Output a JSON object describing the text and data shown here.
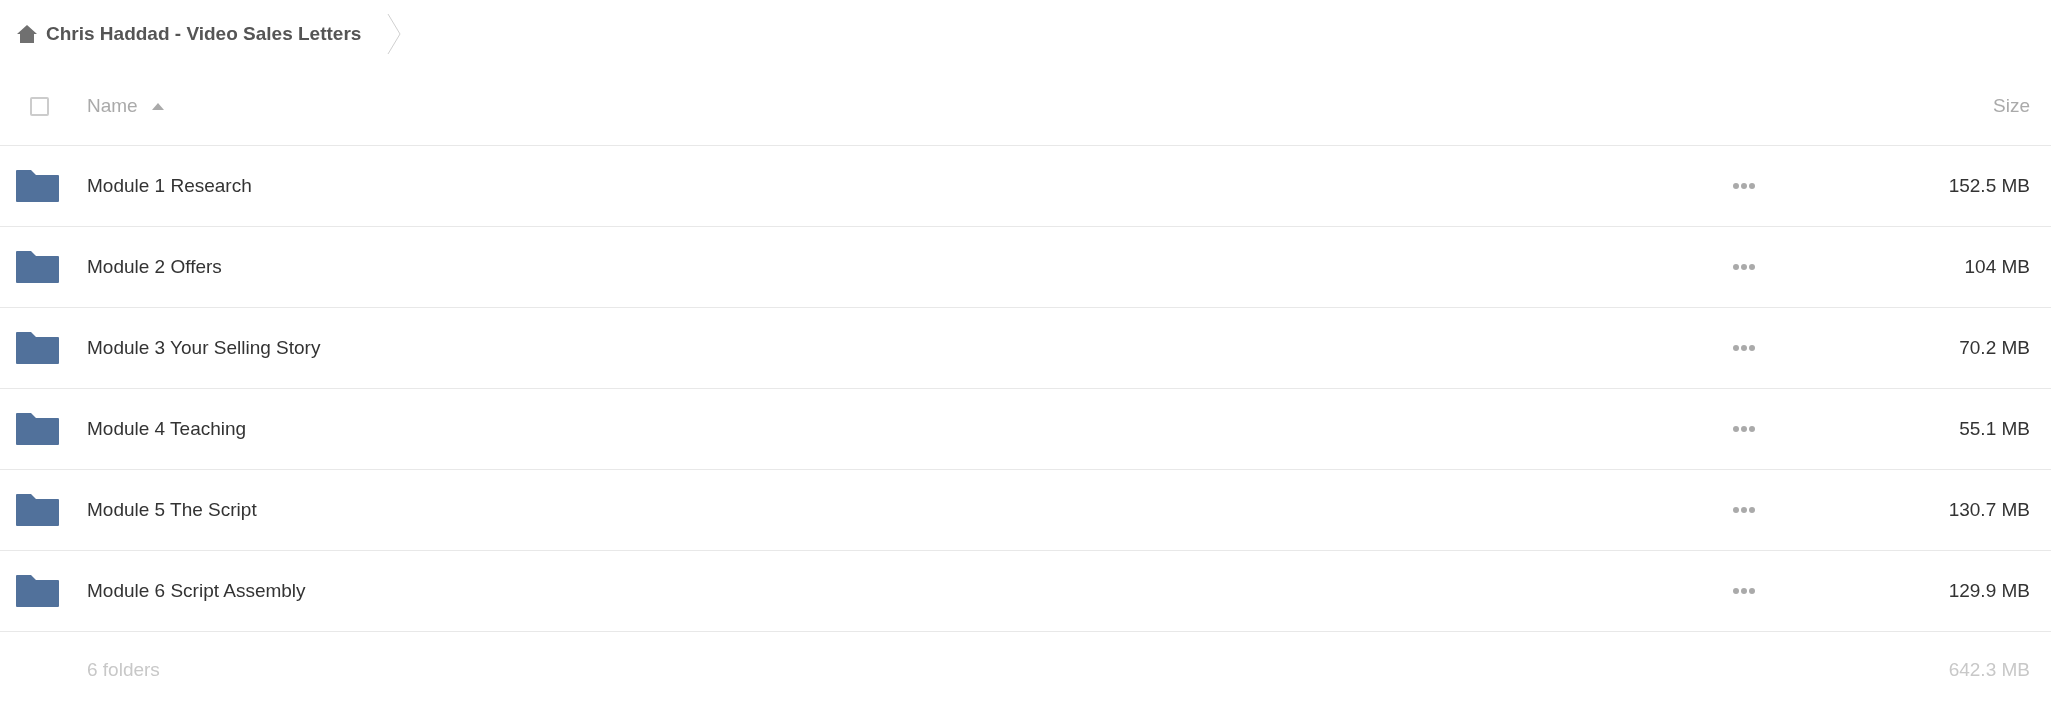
{
  "breadcrumb": {
    "title": "Chris Haddad - Video Sales Letters"
  },
  "header": {
    "select_all": {
      "checked": false
    },
    "name_column": {
      "label": "Name",
      "sort_ascending": true
    },
    "size_column": {
      "label": "Size"
    }
  },
  "rows": [
    {
      "name": "Module 1 Research",
      "size": "152.5 MB"
    },
    {
      "name": "Module 2 Offers",
      "size": "104 MB"
    },
    {
      "name": "Module 3 Your Selling Story",
      "size": "70.2 MB"
    },
    {
      "name": "Module 4 Teaching",
      "size": "55.1 MB"
    },
    {
      "name": "Module 5 The Script",
      "size": "130.7 MB"
    },
    {
      "name": "Module 6 Script Assembly",
      "size": "129.9 MB"
    }
  ],
  "footer": {
    "count": "6 folders",
    "total": "642.3 MB"
  }
}
